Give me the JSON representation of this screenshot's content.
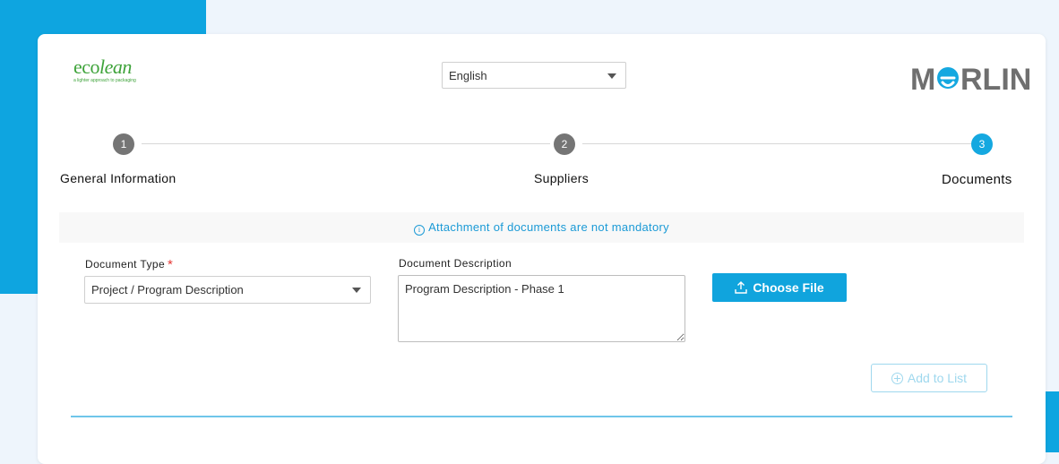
{
  "header": {
    "brand_logo_text": {
      "eco": "eco",
      "lean": "lean",
      "tagline": "a lighter approach to packaging"
    },
    "language": {
      "selected": "English"
    },
    "app_logo_text": "MERLIN"
  },
  "stepper": {
    "steps": [
      {
        "number": "1",
        "label": "General Information",
        "status": "completed"
      },
      {
        "number": "2",
        "label": "Suppliers",
        "status": "completed"
      },
      {
        "number": "3",
        "label": "Documents",
        "status": "active"
      }
    ]
  },
  "info": {
    "message": "Attachment of documents are not mandatory",
    "icon": "info-icon"
  },
  "form": {
    "document_type": {
      "label": "Document Type",
      "required_mark": "*",
      "value": "Project / Program Description"
    },
    "document_description": {
      "label": "Document Description",
      "value": "Program Description - Phase 1"
    },
    "choose_file_label": "Choose File",
    "add_to_list_label": "Add to List"
  },
  "colors": {
    "accent": "#10a4dd",
    "brand_green": "#3ea33a",
    "step_inactive": "#757575",
    "info_text": "#1b9ad6",
    "required": "#e53935"
  }
}
